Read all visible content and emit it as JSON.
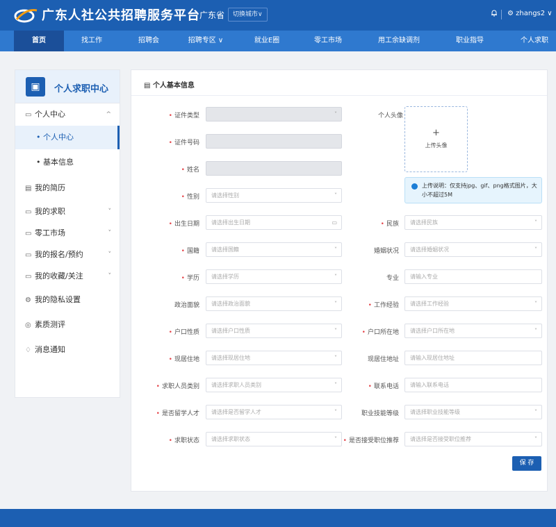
{
  "header": {
    "brand": "广东人社公共招聘服务平台",
    "province": "广东省",
    "switch_city": "切换城市∨",
    "user": "⚙ zhangs2 ∨"
  },
  "nav": [
    "首页",
    "找工作",
    "招聘会",
    "招聘专区 ∨",
    "就业E圈",
    "零工市场",
    "用工余缺调剂",
    "职业指导",
    "个人求职"
  ],
  "sidebar": {
    "title": "个人求职中心",
    "items": [
      {
        "label": "个人中心",
        "icon": "folder-icon",
        "caret": "^"
      },
      {
        "label": "• 个人中心",
        "sub": true,
        "active": true
      },
      {
        "label": "• 基本信息",
        "sub": true
      },
      {
        "label": "我的简历",
        "icon": "document-icon"
      },
      {
        "label": "我的求职",
        "icon": "folder-icon",
        "caret": "˅"
      },
      {
        "label": "零工市场",
        "icon": "folder-icon",
        "caret": "˅"
      },
      {
        "label": "我的报名/预约",
        "icon": "folder-icon",
        "caret": "˅"
      },
      {
        "label": "我的收藏/关注",
        "icon": "folder-icon",
        "caret": "˅"
      },
      {
        "label": "我的隐私设置",
        "icon": "gear-icon"
      },
      {
        "label": "素质测评",
        "icon": "circle-icon"
      },
      {
        "label": "消息通知",
        "icon": "bell-icon"
      }
    ]
  },
  "form": {
    "title": "个人基本信息",
    "avatar_label": "个人头像",
    "avatar_plus": "+",
    "avatar_upload": "上传头像",
    "upload_tip": "上传说明：仅支持jpg、gif、png格式图片，大小不超过5M",
    "save_label": "保 存",
    "fields": [
      {
        "label": "证件类型",
        "required": true,
        "placeholder": "",
        "disabled": true,
        "arrow": "˅"
      },
      {
        "label": "证件号码",
        "required": true,
        "placeholder": "",
        "disabled": true
      },
      {
        "label": "姓名",
        "required": true,
        "placeholder": "",
        "disabled": true
      },
      {
        "label": "性别",
        "required": true,
        "placeholder": "请选择性别",
        "arrow": "˅"
      },
      {
        "label": "出生日期",
        "required": true,
        "placeholder": "请选择出生日期",
        "arrow": "▭"
      },
      {
        "label": "民族",
        "required": true,
        "placeholder": "请选择民族",
        "arrow": "˅"
      },
      {
        "label": "国籍",
        "required": true,
        "placeholder": "请选择国籍",
        "arrow": "˅"
      },
      {
        "label": "婚姻状况",
        "required": false,
        "placeholder": "请选择婚姻状况",
        "arrow": "˅"
      },
      {
        "label": "学历",
        "required": true,
        "placeholder": "请选择学历",
        "arrow": "˅"
      },
      {
        "label": "专业",
        "required": false,
        "placeholder": "请输入专业"
      },
      {
        "label": "政治面貌",
        "required": false,
        "placeholder": "请选择政治面貌",
        "arrow": "˅"
      },
      {
        "label": "工作经验",
        "required": true,
        "placeholder": "请选择工作经验",
        "arrow": "˅"
      },
      {
        "label": "户口性质",
        "required": true,
        "placeholder": "请选择户口性质",
        "arrow": "˅"
      },
      {
        "label": "户口所在地",
        "required": true,
        "placeholder": "请选择户口所在地",
        "arrow": "˅"
      },
      {
        "label": "现居住地",
        "required": true,
        "placeholder": "请选择现居住地",
        "arrow": "˅"
      },
      {
        "label": "现居住地址",
        "required": false,
        "placeholder": "请输入现居住地址"
      },
      {
        "label": "求职人员类别",
        "required": true,
        "placeholder": "请选择求职人员类别",
        "arrow": "˅"
      },
      {
        "label": "联系电话",
        "required": true,
        "placeholder": "请输入联系电话"
      },
      {
        "label": "是否留学人才",
        "required": true,
        "placeholder": "请选择是否留学人才",
        "arrow": "˅"
      },
      {
        "label": "职业技能等级",
        "required": false,
        "placeholder": "请选择职业技能等级",
        "arrow": "˅"
      },
      {
        "label": "求职状态",
        "required": true,
        "placeholder": "请选择求职状态",
        "arrow": "˅"
      },
      {
        "label": "是否接受职位推荐",
        "required": true,
        "placeholder": "请选择是否接受职位推荐",
        "arrow": "˅"
      }
    ]
  },
  "colors": {
    "primary": "#1c5fb2",
    "nav": "#2f79cf",
    "required": "#e5484d"
  }
}
